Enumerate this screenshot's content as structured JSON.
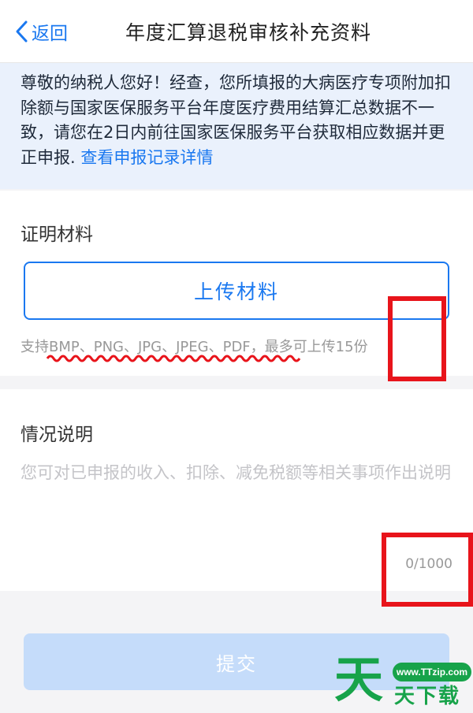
{
  "nav": {
    "back_label": "返回",
    "title": "年度汇算退税审核补充资料"
  },
  "notice": {
    "text": "尊敬的纳税人您好！经查，您所填报的大病医疗专项附加扣除额与国家医保服务平台年度医疗费用结算汇总数据不一致，请您在2日内前往国家医保服务平台获取相应数据并更正申报. ",
    "link": "查看申报记录详情"
  },
  "proof": {
    "title": "证明材料",
    "upload_label": "上传材料",
    "hint": "支持BMP、PNG、JPG、JPEG、PDF，最多可上传15份"
  },
  "description": {
    "title": "情况说明",
    "placeholder": "您可对已申报的收入、扣除、减免税额等相关事项作出说明",
    "value": "",
    "counter": "0/1000"
  },
  "submit_label": "提交",
  "watermark": {
    "big": "天",
    "url": "www.TTzip.com",
    "small": "天下载"
  },
  "colors": {
    "accent": "#1a78f0",
    "notice_bg": "#eaf1fc",
    "submit_disabled": "#c5dcfa",
    "annotation_red": "#e8141b",
    "watermark_green": "#17a34a"
  }
}
